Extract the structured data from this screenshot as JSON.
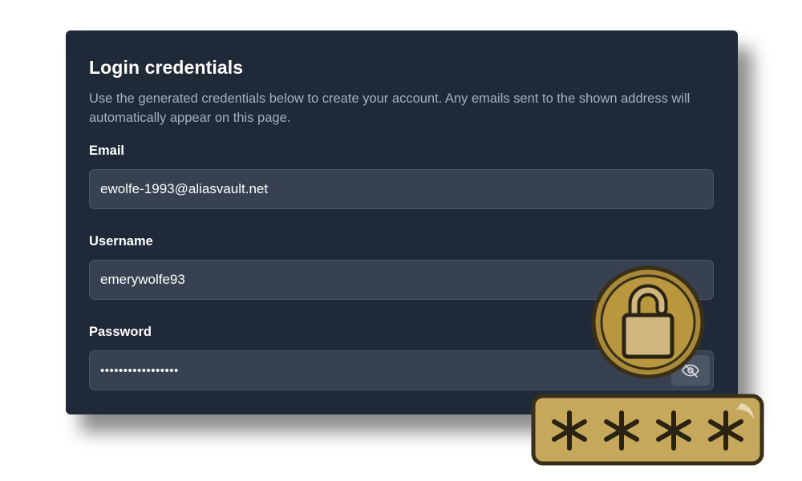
{
  "card": {
    "title": "Login credentials",
    "description": "Use the generated credentials below to create your account. Any emails sent to the shown address will automatically appear on this page."
  },
  "fields": {
    "email": {
      "label": "Email",
      "value": "ewolfe-1993@aliasvault.net"
    },
    "username": {
      "label": "Username",
      "value": "emerywolfe93"
    },
    "password": {
      "label": "Password",
      "value": "•••••••••••••••••"
    }
  },
  "icons": {
    "toggle_visibility": "eye-slash-icon",
    "badge": "unlocked-padlock-icon",
    "password_mask": "asterisks-icon"
  },
  "colors": {
    "card_bg": "#1f2937",
    "field_bg": "#374151",
    "gold": "#b8973f",
    "gold_light": "#cfb77f",
    "outline": "#3a2f18"
  }
}
